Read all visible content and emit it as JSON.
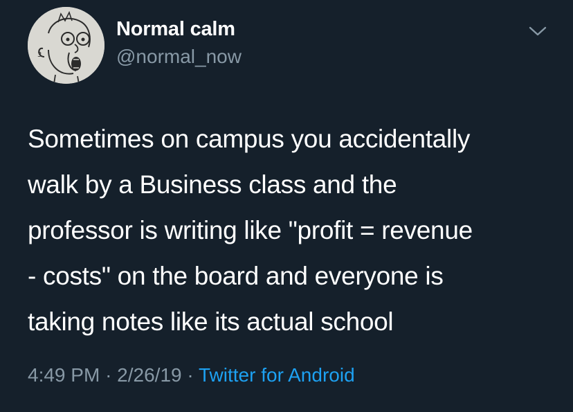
{
  "author": {
    "display_name": "Normal calm",
    "handle": "@normal_now",
    "avatar_icon": "cartoon-face-avatar"
  },
  "menu": {
    "icon": "chevron-down-icon"
  },
  "tweet": {
    "lines": [
      "Sometimes on campus you accidentally",
      "walk by a Business class and the",
      "professor is writing like \"profit = revenue",
      "- costs\" on the board and everyone is",
      "taking notes like its actual school"
    ]
  },
  "meta": {
    "time": "4:49 PM",
    "separator": "·",
    "date": "2/26/19",
    "source": "Twitter for Android"
  },
  "colors": {
    "background": "#15202b",
    "text_primary": "#ffffff",
    "text_secondary": "#8899a6",
    "link": "#1da1f2"
  }
}
